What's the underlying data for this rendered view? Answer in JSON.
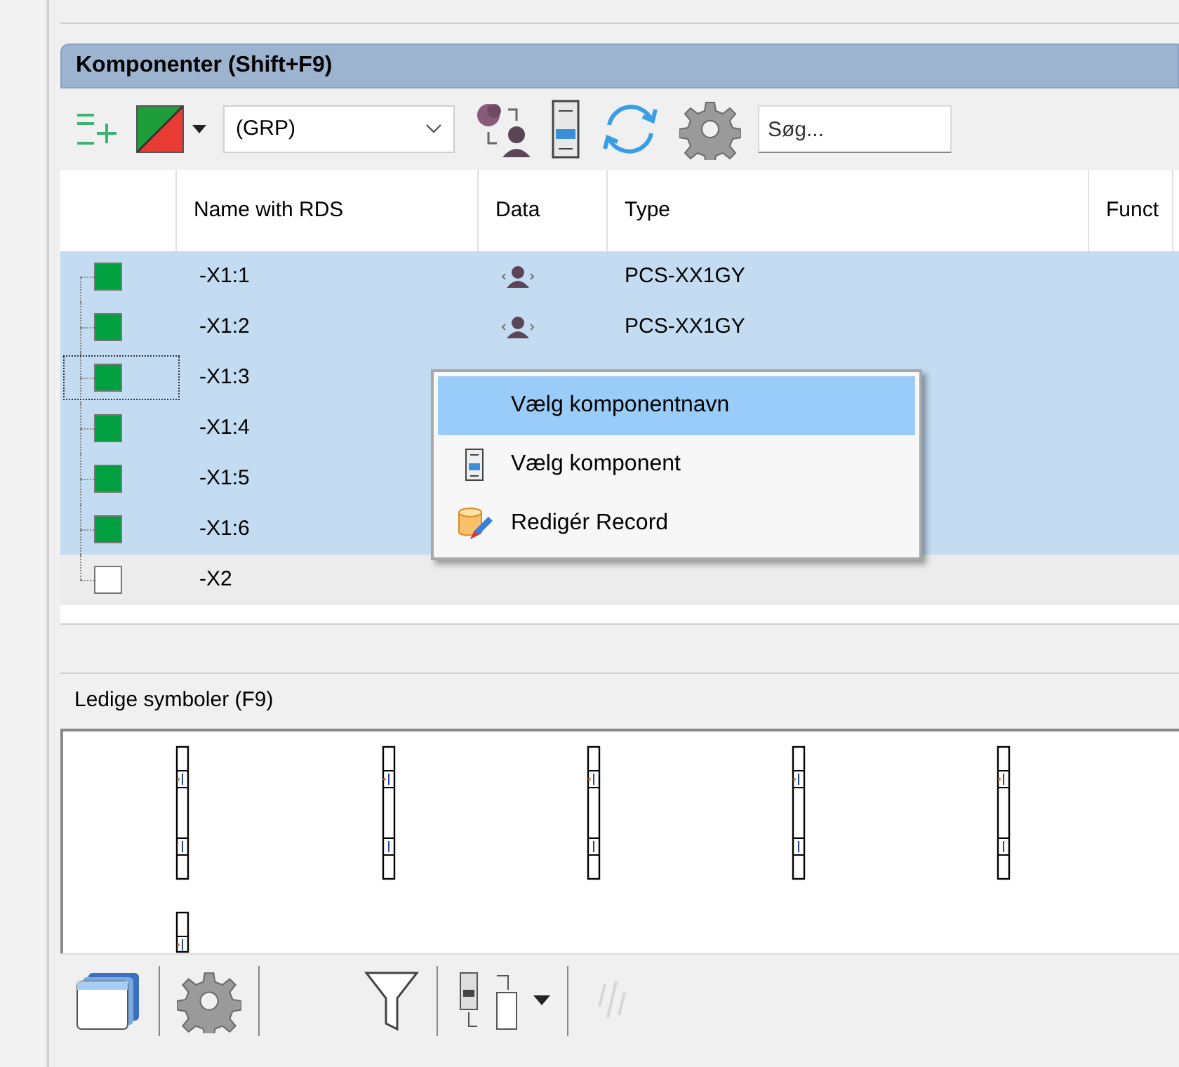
{
  "panel_title": "Komponenter (Shift+F9)",
  "toolbar": {
    "group_select": {
      "value": "(GRP)"
    },
    "search": {
      "placeholder": "Søg..."
    }
  },
  "table": {
    "columns": [
      "Name with RDS",
      "Data",
      "Type",
      "Funct"
    ],
    "rows": [
      {
        "name": "-X1:1",
        "selected": true,
        "focused": false,
        "color": "#00a040",
        "data_icon": true,
        "type": "PCS-XX1GY"
      },
      {
        "name": "-X1:2",
        "selected": true,
        "focused": false,
        "color": "#00a040",
        "data_icon": true,
        "type": "PCS-XX1GY"
      },
      {
        "name": "-X1:3",
        "selected": true,
        "focused": true,
        "color": "#00a040"
      },
      {
        "name": "-X1:4",
        "selected": true,
        "focused": false,
        "color": "#00a040"
      },
      {
        "name": "-X1:5",
        "selected": true,
        "focused": false,
        "color": "#00a040"
      },
      {
        "name": "-X1:6",
        "selected": true,
        "focused": false,
        "color": "#00a040"
      },
      {
        "name": "-X2",
        "selected": false,
        "focused": false,
        "color": "#ffffff"
      }
    ]
  },
  "context_menu": [
    {
      "label": "Vælg komponentnavn",
      "selected": true,
      "kind": "plain"
    },
    {
      "label": "Vælg komponent",
      "selected": false,
      "kind": "component"
    },
    {
      "label": "Redigér Record",
      "selected": false,
      "kind": "record"
    }
  ],
  "symbols_panel": {
    "title": "Ledige symboler (F9)",
    "symbols": [
      {
        "kind": "tall"
      },
      {
        "kind": "tall"
      },
      {
        "kind": "tall"
      },
      {
        "kind": "tall"
      },
      {
        "kind": "tall"
      },
      {
        "kind": "short"
      }
    ]
  }
}
